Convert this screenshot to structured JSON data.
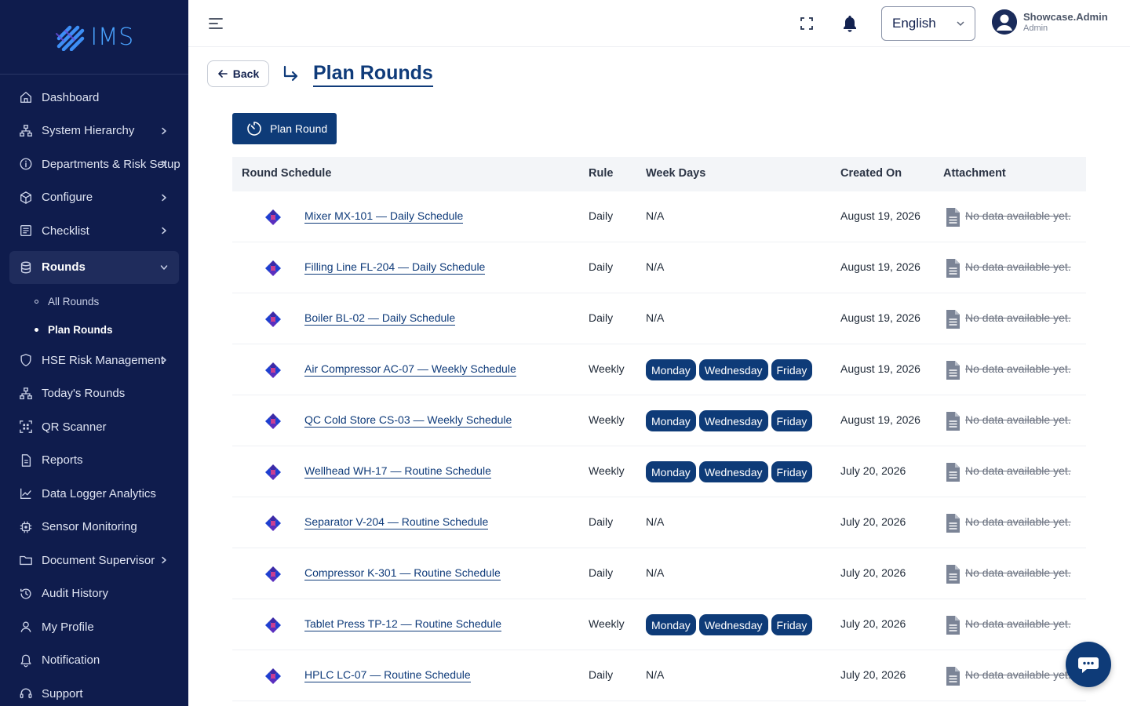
{
  "brand": {
    "name": "IMS"
  },
  "colors": {
    "sidebar_bg": "#0f1c4d",
    "primary": "#0e3b78",
    "brand_accent": "#4aa3ff"
  },
  "sidebar": {
    "items": [
      {
        "label": "Dashboard",
        "icon": "home-icon"
      },
      {
        "label": "System Hierarchy",
        "icon": "hierarchy-icon",
        "has_children": true
      },
      {
        "label": "Departments & Risk Setup",
        "icon": "info-circle-icon",
        "has_children": true
      },
      {
        "label": "Configure",
        "icon": "cube-icon",
        "has_children": true
      },
      {
        "label": "Checklist",
        "icon": "checklist-icon",
        "has_children": true
      },
      {
        "label": "Rounds",
        "icon": "database-icon",
        "has_children": true,
        "expanded": true,
        "children": [
          {
            "label": "All Rounds"
          },
          {
            "label": "Plan Rounds",
            "current": true
          }
        ]
      },
      {
        "label": "HSE Risk Management",
        "icon": "shield-icon",
        "has_children": true
      },
      {
        "label": "Today's Rounds",
        "icon": "hierarchy-icon"
      },
      {
        "label": "QR Scanner",
        "icon": "qr-icon"
      },
      {
        "label": "Reports",
        "icon": "report-icon"
      },
      {
        "label": "Data Logger Analytics",
        "icon": "chart-line-icon"
      },
      {
        "label": "Sensor Monitoring",
        "icon": "sensor-icon"
      },
      {
        "label": "Document Supervisor",
        "icon": "folder-icon",
        "has_children": true
      },
      {
        "label": "Audit History",
        "icon": "history-icon"
      },
      {
        "label": "My Profile",
        "icon": "user-icon"
      },
      {
        "label": "Notification",
        "icon": "bell-icon"
      },
      {
        "label": "Support",
        "icon": "headset-icon"
      }
    ]
  },
  "header": {
    "language": "English",
    "user": {
      "name": "Showcase.Admin",
      "role": "Admin"
    }
  },
  "page": {
    "back_label": "Back",
    "title": "Plan Rounds",
    "plan_button_label": "Plan Round"
  },
  "table": {
    "columns": [
      "Round Schedule",
      "Rule",
      "Week Days",
      "Created On",
      "Attachment"
    ],
    "rows": [
      {
        "schedule": "Mixer MX-101 — Daily Schedule",
        "rule": "Daily",
        "days": [],
        "days_text": "N/A",
        "created": "August 19, 2026",
        "attachment": "No data available yet."
      },
      {
        "schedule": "Filling Line FL-204 — Daily Schedule",
        "rule": "Daily",
        "days": [],
        "days_text": "N/A",
        "created": "August 19, 2026",
        "attachment": "No data available yet."
      },
      {
        "schedule": "Boiler BL-02 — Daily Schedule",
        "rule": "Daily",
        "days": [],
        "days_text": "N/A",
        "created": "August 19, 2026",
        "attachment": "No data available yet."
      },
      {
        "schedule": "Air Compressor AC-07 — Weekly Schedule",
        "rule": "Weekly",
        "days": [
          "Monday",
          "Wednesday",
          "Friday"
        ],
        "days_text": "",
        "created": "August 19, 2026",
        "attachment": "No data available yet."
      },
      {
        "schedule": "QC Cold Store CS-03 — Weekly Schedule",
        "rule": "Weekly",
        "days": [
          "Monday",
          "Wednesday",
          "Friday"
        ],
        "days_text": "",
        "created": "August 19, 2026",
        "attachment": "No data available yet."
      },
      {
        "schedule": "Wellhead WH-17 — Routine Schedule",
        "rule": "Weekly",
        "days": [
          "Monday",
          "Wednesday",
          "Friday"
        ],
        "days_text": "",
        "created": "July 20, 2026",
        "attachment": "No data available yet."
      },
      {
        "schedule": "Separator V-204 — Routine Schedule",
        "rule": "Daily",
        "days": [],
        "days_text": "N/A",
        "created": "July 20, 2026",
        "attachment": "No data available yet."
      },
      {
        "schedule": "Compressor K-301 — Routine Schedule",
        "rule": "Daily",
        "days": [],
        "days_text": "N/A",
        "created": "July 20, 2026",
        "attachment": "No data available yet."
      },
      {
        "schedule": "Tablet Press TP-12 — Routine Schedule",
        "rule": "Weekly",
        "days": [
          "Monday",
          "Wednesday",
          "Friday"
        ],
        "days_text": "",
        "created": "July 20, 2026",
        "attachment": "No data available yet."
      },
      {
        "schedule": "HPLC LC-07 — Routine Schedule",
        "rule": "Daily",
        "days": [],
        "days_text": "N/A",
        "created": "July 20, 2026",
        "attachment": "No data available yet."
      }
    ]
  }
}
